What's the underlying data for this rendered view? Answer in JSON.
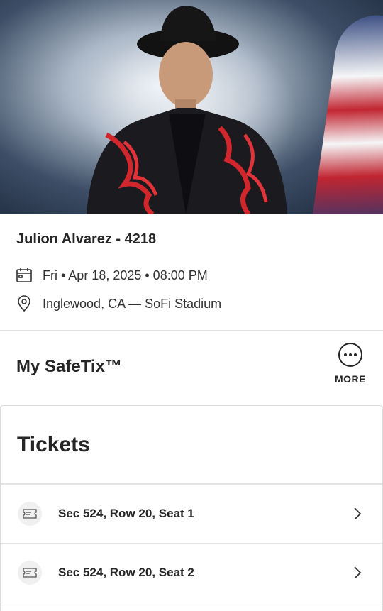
{
  "event": {
    "title": "Julion Alvarez - 4218",
    "date_time": "Fri • Apr 18, 2025 • 08:00 PM",
    "location": "Inglewood, CA — SoFi Stadium"
  },
  "safetix": {
    "title": "My SafeTix™",
    "more_label": "MORE"
  },
  "tickets": {
    "title": "Tickets",
    "items": [
      {
        "label": "Sec 524, Row 20, Seat 1"
      },
      {
        "label": "Sec 524, Row 20, Seat 2"
      }
    ]
  },
  "icons": {
    "date": "calendar-icon",
    "venue": "location-pin-icon",
    "more": "more-dots-icon",
    "ticket": "ticket-icon",
    "chevron": "chevron-right-icon"
  }
}
